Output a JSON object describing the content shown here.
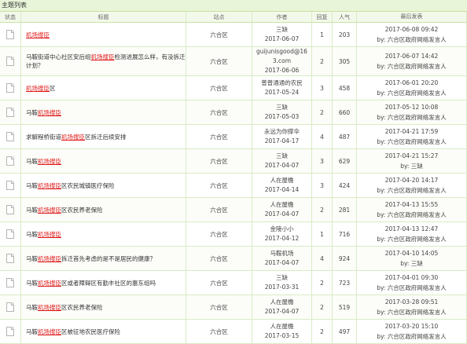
{
  "panel": {
    "title": "主题列表"
  },
  "columns": {
    "status": "状态",
    "title": "标题",
    "site": "站点",
    "author": "作者",
    "reply": "回复",
    "views": "人气",
    "last": "最后发表"
  },
  "rows": [
    {
      "pre": "",
      "hl": "机场搜臣",
      "post": "",
      "site": "六合区",
      "author": "三缺",
      "date": "2017-06-07",
      "replies": "1",
      "views": "203",
      "last_time": "2017-06-08 09:42",
      "last_by": "by: 六合区政府网络发言人"
    },
    {
      "pre": "马鞍街道中心社区安后组",
      "hl": "机场搜臣",
      "post": "检测进展怎么样，有没拆迁",
      "post2": "计划？",
      "site": "六合区",
      "author": "guijunisgood@163.com",
      "author_l1": "guijunisgood@16",
      "author_l2": "3.com",
      "date": "2017-06-06",
      "replies": "2",
      "views": "305",
      "last_time": "2017-06-07 14:42",
      "last_by": "by: 六合区政府网络发言人"
    },
    {
      "pre": "",
      "hl": "机场搜臣",
      "post": "区",
      "site": "六合区",
      "author": "普普通通的农民",
      "date": "2017-05-24",
      "replies": "3",
      "views": "458",
      "last_time": "2017-06-01 20:20",
      "last_by": "by: 六合区政府网络发言人"
    },
    {
      "pre": "马鞍",
      "hl": "机场搜臣",
      "post": "",
      "site": "六合区",
      "author": "三缺",
      "date": "2017-05-03",
      "replies": "2",
      "views": "660",
      "last_time": "2017-05-12 10:08",
      "last_by": "by: 六合区政府网络发言人"
    },
    {
      "pre": "求解程桥街道",
      "hl": "机场搜臣",
      "post": "区拆迁后续安排",
      "site": "六合区",
      "author": "永远为你撑伞",
      "date": "2017-04-17",
      "replies": "4",
      "views": "487",
      "last_time": "2017-04-21 17:59",
      "last_by": "by: 六合区政府网络发言人"
    },
    {
      "pre": "马鞍",
      "hl": "机场搜臣",
      "post": "",
      "site": "六合区",
      "author": "三缺",
      "date": "2017-04-07",
      "replies": "3",
      "views": "629",
      "last_time": "2017-04-21 15:27",
      "last_by": "by: 三缺"
    },
    {
      "pre": "马鞍",
      "hl": "机场搜臣",
      "post": "区农民城镇医疗保险",
      "site": "六合区",
      "author": "人在屋檐",
      "date": "2017-04-14",
      "replies": "3",
      "views": "424",
      "last_time": "2017-04-20 14:17",
      "last_by": "by: 六合区政府网络发言人"
    },
    {
      "pre": "马鞍",
      "hl": "机场搜臣",
      "post": "区农民养老保险",
      "site": "六合区",
      "author": "人在屋檐",
      "date": "2017-04-07",
      "replies": "2",
      "views": "281",
      "last_time": "2017-04-13 15:55",
      "last_by": "by: 六合区政府网络发言人"
    },
    {
      "pre": "马鞍",
      "hl": "机场搜臣",
      "post": "",
      "site": "六合区",
      "author": "金陵小小",
      "date": "2017-04-12",
      "replies": "1",
      "views": "716",
      "last_time": "2017-04-13 12:47",
      "last_by": "by: 六合区政府网络发言人"
    },
    {
      "pre": "马鞍",
      "hl": "机场搜臣",
      "post": "拆迁首先考虑的是不是居民的健康？",
      "site": "六合区",
      "author": "马鞍机场",
      "date": "2017-04-07",
      "replies": "4",
      "views": "924",
      "last_time": "2017-04-10 14:05",
      "last_by": "by: 三缺"
    },
    {
      "pre": "马鞍",
      "hl": "机场搜臣",
      "post": "区或者障碍区有勤丰社区的惠东组吗",
      "site": "六合区",
      "author": "三缺",
      "date": "2017-03-31",
      "replies": "2",
      "views": "723",
      "last_time": "2017-04-01 09:30",
      "last_by": "by: 六合区政府网络发言人"
    },
    {
      "pre": "马鞍",
      "hl": "机场搜臣",
      "post": "区农民养老保险",
      "site": "六合区",
      "author": "人在屋檐",
      "date": "2017-04-07",
      "replies": "2",
      "views": "519",
      "last_time": "2017-03-28 09:51",
      "last_by": "by: 六合区政府网络发言人"
    },
    {
      "pre": "马鞍",
      "hl": "机场搜臣",
      "post": "区被征地农民医疗保险",
      "site": "六合区",
      "author": "人在屋檐",
      "date": "2017-03-15",
      "replies": "2",
      "views": "497",
      "last_time": "2017-03-20 15:10",
      "last_by": "by: 六合区政府网络发言人"
    }
  ]
}
